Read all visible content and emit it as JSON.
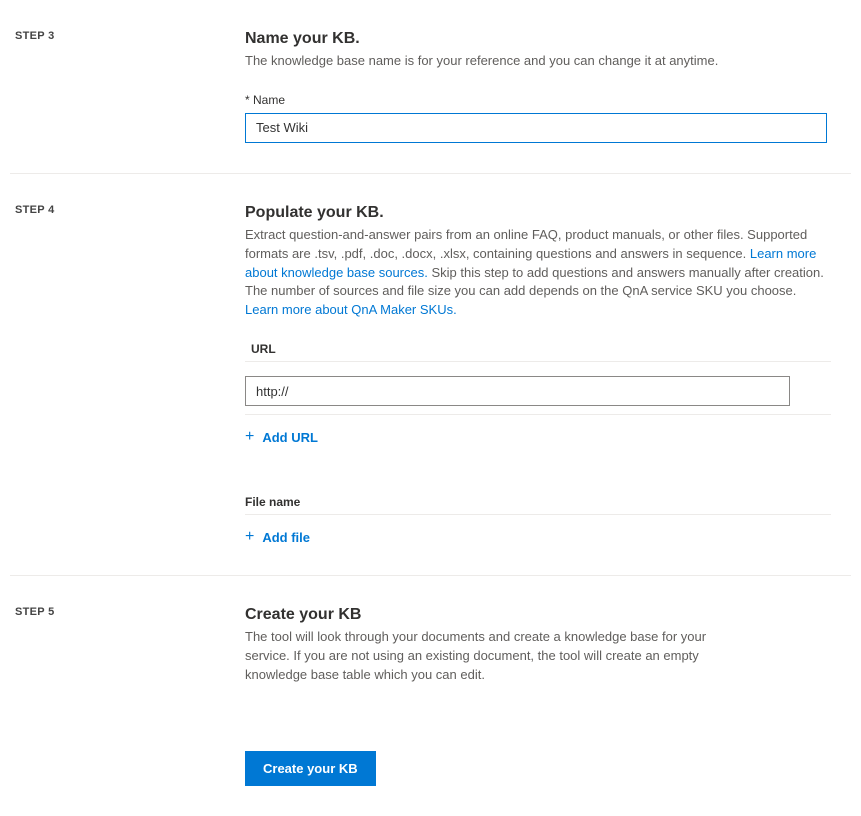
{
  "step3": {
    "label": "STEP 3",
    "title": "Name your KB.",
    "desc": "The knowledge base name is for your reference and you can change it at anytime.",
    "name_field_label": "* Name",
    "name_value": "Test Wiki"
  },
  "step4": {
    "label": "STEP 4",
    "title": "Populate your KB.",
    "desc_part1": "Extract question-and-answer pairs from an online FAQ, product manuals, or other files. Supported formats are .tsv, .pdf, .doc, .docx, .xlsx, containing questions and answers in sequence. ",
    "link1": "Learn more about knowledge base sources.",
    "desc_part2": " Skip this step to add questions and answers manually after creation. The number of sources and file size you can add depends on the QnA service SKU you choose. ",
    "link2": "Learn more about QnA Maker SKUs.",
    "url_section_label": "URL",
    "url_value": "http://",
    "add_url_label": "Add URL",
    "file_section_label": "File name",
    "add_file_label": "Add file"
  },
  "step5": {
    "label": "STEP 5",
    "title": "Create your KB",
    "desc": "The tool will look through your documents and create a knowledge base for your service. If you are not using an existing document, the tool will create an empty knowledge base table which you can edit.",
    "create_button_label": "Create your KB"
  }
}
